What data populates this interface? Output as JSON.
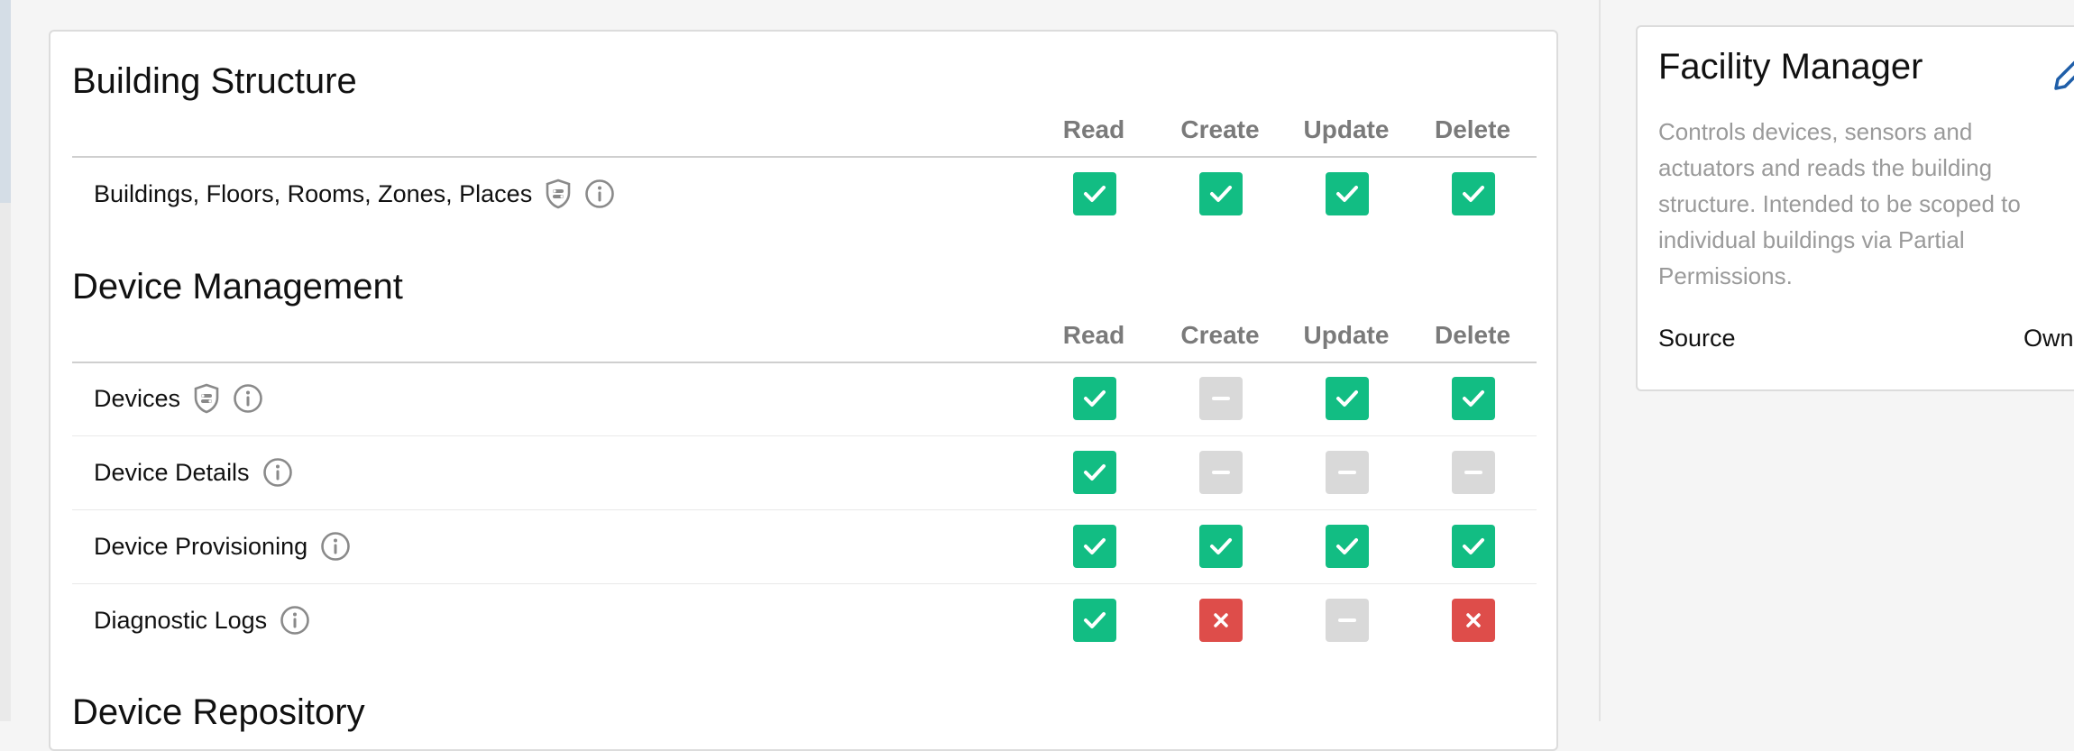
{
  "columns": [
    "Read",
    "Create",
    "Update",
    "Delete"
  ],
  "sections": [
    {
      "title": "Building Structure",
      "rows": [
        {
          "label": "Buildings, Floors, Rooms, Zones, Places",
          "icons": [
            "shield-icon",
            "info-icon"
          ],
          "states": [
            "check",
            "check",
            "check",
            "check"
          ]
        }
      ]
    },
    {
      "title": "Device Management",
      "rows": [
        {
          "label": "Devices",
          "icons": [
            "shield-icon",
            "info-icon"
          ],
          "states": [
            "check",
            "none",
            "check",
            "check"
          ]
        },
        {
          "label": "Device Details",
          "icons": [
            "info-icon"
          ],
          "states": [
            "check",
            "none",
            "none",
            "none"
          ]
        },
        {
          "label": "Device Provisioning",
          "icons": [
            "info-icon"
          ],
          "states": [
            "check",
            "check",
            "check",
            "check"
          ]
        },
        {
          "label": "Diagnostic Logs",
          "icons": [
            "info-icon"
          ],
          "states": [
            "check",
            "deny",
            "none",
            "deny"
          ]
        }
      ]
    },
    {
      "title": "Device Repository",
      "rows": []
    }
  ],
  "role_card": {
    "title": "Facility Manager",
    "description": "Controls devices, sensors and actuators and reads the building structure. Intended to be scoped to individual buildings via Partial Permissions.",
    "source_label": "Source",
    "source_value": "Own",
    "edit_icon": "pencil-icon"
  },
  "colors": {
    "granted": "#12bd83",
    "not_applicable": "#d9d9d9",
    "denied": "#de4d4a",
    "muted_text": "#9a9a9a",
    "column_header": "#7a7a7a"
  }
}
